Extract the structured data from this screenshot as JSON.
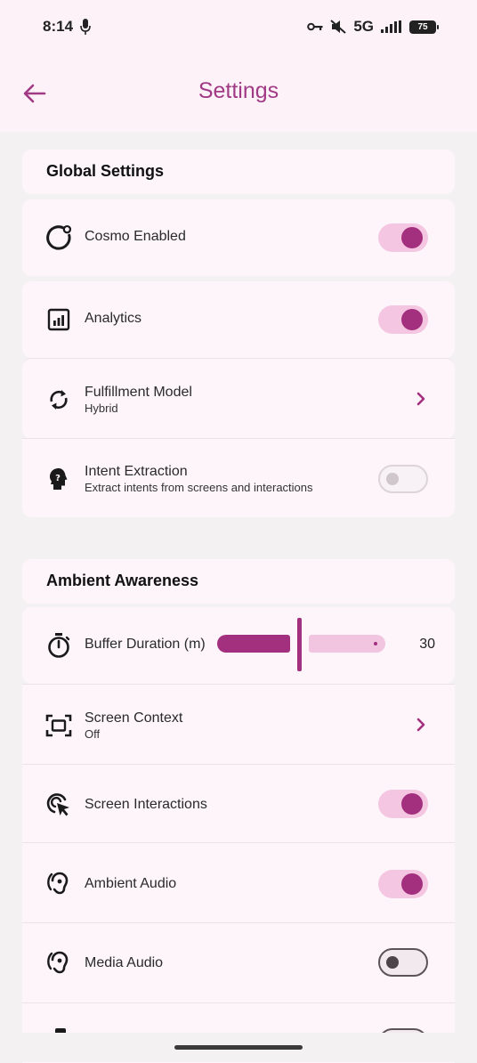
{
  "status_bar": {
    "time": "8:14",
    "network": "5G",
    "battery": "75"
  },
  "app_bar": {
    "title": "Settings"
  },
  "global_settings": {
    "title": "Global Settings",
    "items": [
      {
        "label": "Cosmo Enabled",
        "icon": "cosmo-icon",
        "toggle": true
      },
      {
        "label": "Analytics",
        "icon": "analytics-icon",
        "toggle": true
      },
      {
        "label": "Fulfillment Model",
        "subtitle": "Hybrid",
        "icon": "sync-icon"
      },
      {
        "label": "Intent Extraction",
        "subtitle": "Extract intents from screens and interactions",
        "icon": "psychology-icon",
        "toggle": false
      }
    ]
  },
  "ambient_awareness": {
    "title": "Ambient Awareness",
    "buffer": {
      "label": "Buffer Duration (m)",
      "value": "30",
      "slider_fraction": 0.45
    },
    "items": [
      {
        "label": "Screen Context",
        "subtitle": "Off",
        "icon": "screenshot-frame-icon"
      },
      {
        "label": "Screen Interactions",
        "icon": "touch-cursor-icon",
        "toggle": true
      },
      {
        "label": "Ambient Audio",
        "icon": "ear-icon",
        "toggle": true
      },
      {
        "label": "Media Audio",
        "icon": "ear-icon",
        "toggle": false
      }
    ]
  },
  "colors": {
    "accent": "#a3307f",
    "accent_light": "#f5c6e1",
    "header_bg": "#fdf2f8",
    "card_bg": "#fdf5fa",
    "page_bg": "#f3f1f2"
  }
}
